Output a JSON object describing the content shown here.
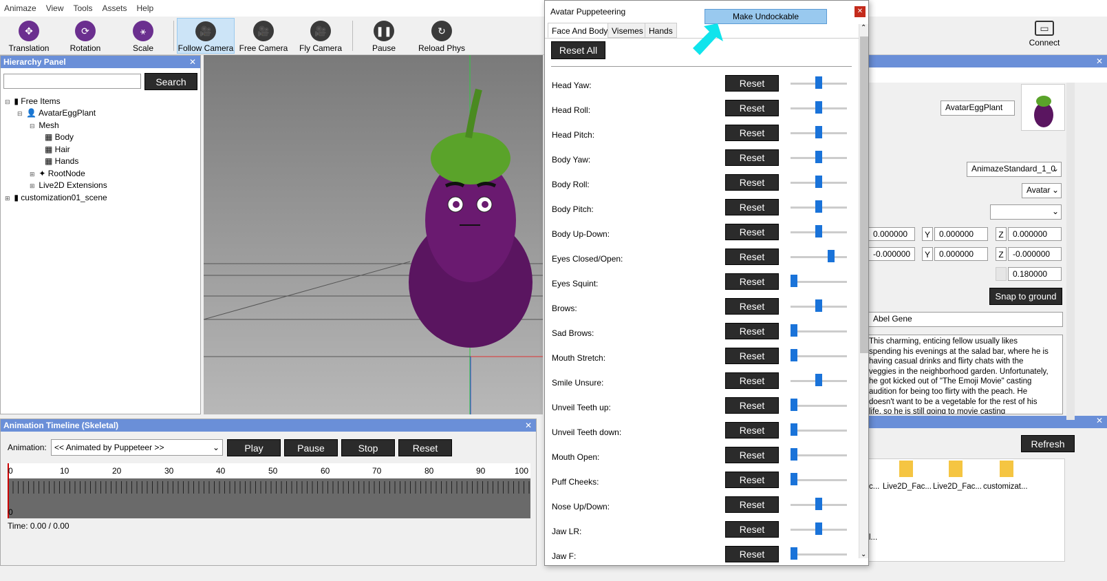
{
  "menu": [
    "Animaze",
    "View",
    "Tools",
    "Assets",
    "Help"
  ],
  "toolbar": {
    "translation": "Translation",
    "rotation": "Rotation",
    "scale": "Scale",
    "follow_camera": "Follow Camera",
    "free_camera": "Free Camera",
    "fly_camera": "Fly Camera",
    "pause": "Pause",
    "reload_phys": "Reload Phys",
    "connect": "Connect"
  },
  "hierarchy": {
    "title": "Hierarchy Panel",
    "search_button": "Search",
    "nodes": [
      "Free Items",
      "AvatarEggPlant",
      "Mesh",
      "Body",
      "Hair",
      "Hands",
      "RootNode",
      "Live2D Extensions",
      "customization01_scene"
    ]
  },
  "animation": {
    "title": "Animation Timeline (Skeletal)",
    "label": "Animation:",
    "selected": "<< Animated by Puppeteer >>",
    "buttons": [
      "Play",
      "Pause",
      "Stop",
      "Reset"
    ],
    "ticks": [
      "0",
      "10",
      "20",
      "30",
      "40",
      "50",
      "60",
      "70",
      "80",
      "90",
      "100"
    ],
    "track_zero": "0",
    "time": "Time: 0.00 / 0.00"
  },
  "puppet": {
    "title": "Avatar Puppeteering",
    "tabs": [
      "Face And Body",
      "Visemes",
      "Hands"
    ],
    "reset_all": "Reset All",
    "reset_label": "Reset",
    "make_undockable": "Make Undockable",
    "rows": [
      {
        "label": "Head Yaw:",
        "level": 0.5
      },
      {
        "label": "Head Roll:",
        "level": 0.5
      },
      {
        "label": "Head Pitch:",
        "level": 0.5
      },
      {
        "label": "Body Yaw:",
        "level": 0.5
      },
      {
        "label": "Body Roll:",
        "level": 0.5
      },
      {
        "label": "Body Pitch:",
        "level": 0.5
      },
      {
        "label": "Body Up-Down:",
        "level": 0.5
      },
      {
        "label": "Eyes Closed/Open:",
        "level": 0.75
      },
      {
        "label": "Eyes Squint:",
        "level": 0.0
      },
      {
        "label": "Brows:",
        "level": 0.5
      },
      {
        "label": "Sad Brows:",
        "level": 0.0
      },
      {
        "label": "Mouth Stretch:",
        "level": 0.0
      },
      {
        "label": "Smile Unsure:",
        "level": 0.5
      },
      {
        "label": "Unveil Teeth up:",
        "level": 0.0
      },
      {
        "label": "Unveil Teeth down:",
        "level": 0.0
      },
      {
        "label": "Mouth Open:",
        "level": 0.0
      },
      {
        "label": "Puff Cheeks:",
        "level": 0.0
      },
      {
        "label": "Nose Up/Down:",
        "level": 0.5
      },
      {
        "label": "Jaw LR:",
        "level": 0.5
      },
      {
        "label": "Jaw F:",
        "level": 0.0
      }
    ]
  },
  "properties": {
    "name": "AvatarEggPlant",
    "behavior": "AnimazeStandard_1_0",
    "type": "Avatar",
    "pos": [
      "0.000000",
      "0.000000",
      "0.000000"
    ],
    "rot": [
      "-0.000000",
      "0.000000",
      "-0.000000"
    ],
    "scale": "0.180000",
    "axis_y": "Y",
    "axis_z": "Z",
    "snap": "Snap to ground",
    "author": "Abel Gene",
    "description": "This charming, enticing fellow usually likes spending his evenings at the salad bar, where he is having casual drinks and flirty chats with the veggies in the neighborhood garden. Unfortunately, he got kicked out of \"The Emoji Movie\" casting audition for being too flirty with the peach. He doesn't want to be a vegetable for the rest of his life, so he is still going to movie casting",
    "refresh": "Refresh",
    "folders": [
      "c...",
      "Live2D_Fac...",
      "Live2D_Fac...",
      "customizat..."
    ],
    "dots": "l..."
  }
}
